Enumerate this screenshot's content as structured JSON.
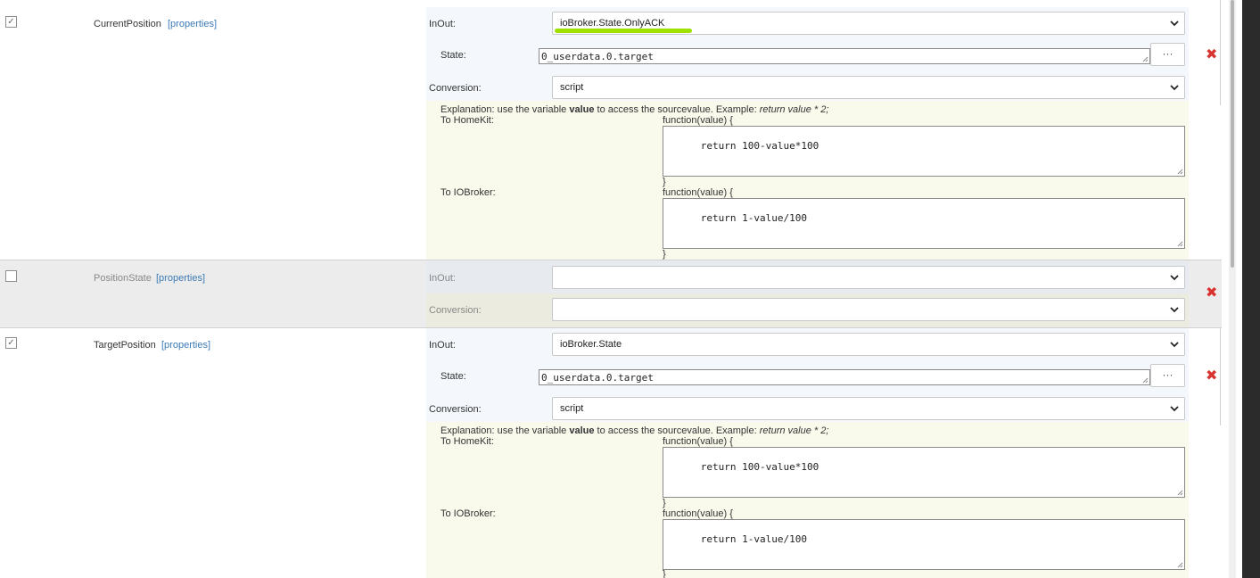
{
  "rows": [
    {
      "checked": "✓",
      "name": "CurrentPosition",
      "properties_link": "[properties]",
      "inout_label": "InOut:",
      "inout_value": "ioBroker.State.OnlyACK",
      "state_label": "State:",
      "state_value": "0_userdata.0.target",
      "more_button": "···",
      "conversion_label": "Conversion:",
      "conversion_value": "script",
      "explanation_prefix": "Explanation: use the variable ",
      "explanation_bold": "value",
      "explanation_mid": " to access the sourcevalue. Example: ",
      "explanation_italic": "return value * 2;",
      "to_homekit_label": "To HomeKit:",
      "to_homekit_fn_open": "function(value) {",
      "to_homekit_code": "return 100-value*100",
      "to_homekit_fn_close": "}",
      "to_iobroker_label": "To IOBroker:",
      "to_iobroker_fn_open": "function(value) {",
      "to_iobroker_code": "return 1-value/100",
      "to_iobroker_fn_close": "}",
      "delete_icon": "✖"
    },
    {
      "checked": "",
      "name": "PositionState",
      "properties_link": "[properties]",
      "inout_label": "InOut:",
      "inout_value": "",
      "conversion_label": "Conversion:",
      "conversion_value": "",
      "delete_icon": "✖"
    },
    {
      "checked": "✓",
      "name": "TargetPosition",
      "properties_link": "[properties]",
      "inout_label": "InOut:",
      "inout_value": "ioBroker.State",
      "state_label": "State:",
      "state_value": "0_userdata.0.target",
      "more_button": "···",
      "conversion_label": "Conversion:",
      "conversion_value": "script",
      "explanation_prefix": "Explanation: use the variable ",
      "explanation_bold": "value",
      "explanation_mid": " to access the sourcevalue. Example: ",
      "explanation_italic": "return value * 2;",
      "to_homekit_label": "To HomeKit:",
      "to_homekit_fn_open": "function(value) {",
      "to_homekit_code": "return 100-value*100",
      "to_homekit_fn_close": "}",
      "to_iobroker_label": "To IOBroker:",
      "to_iobroker_fn_open": "function(value) {",
      "to_iobroker_code": "return 1-value/100",
      "to_iobroker_fn_close": "}",
      "delete_icon": "✖"
    }
  ],
  "colors": {
    "highlight_underline": "#9ee000",
    "delete": "#d9332f",
    "link": "#3c7ab5"
  }
}
